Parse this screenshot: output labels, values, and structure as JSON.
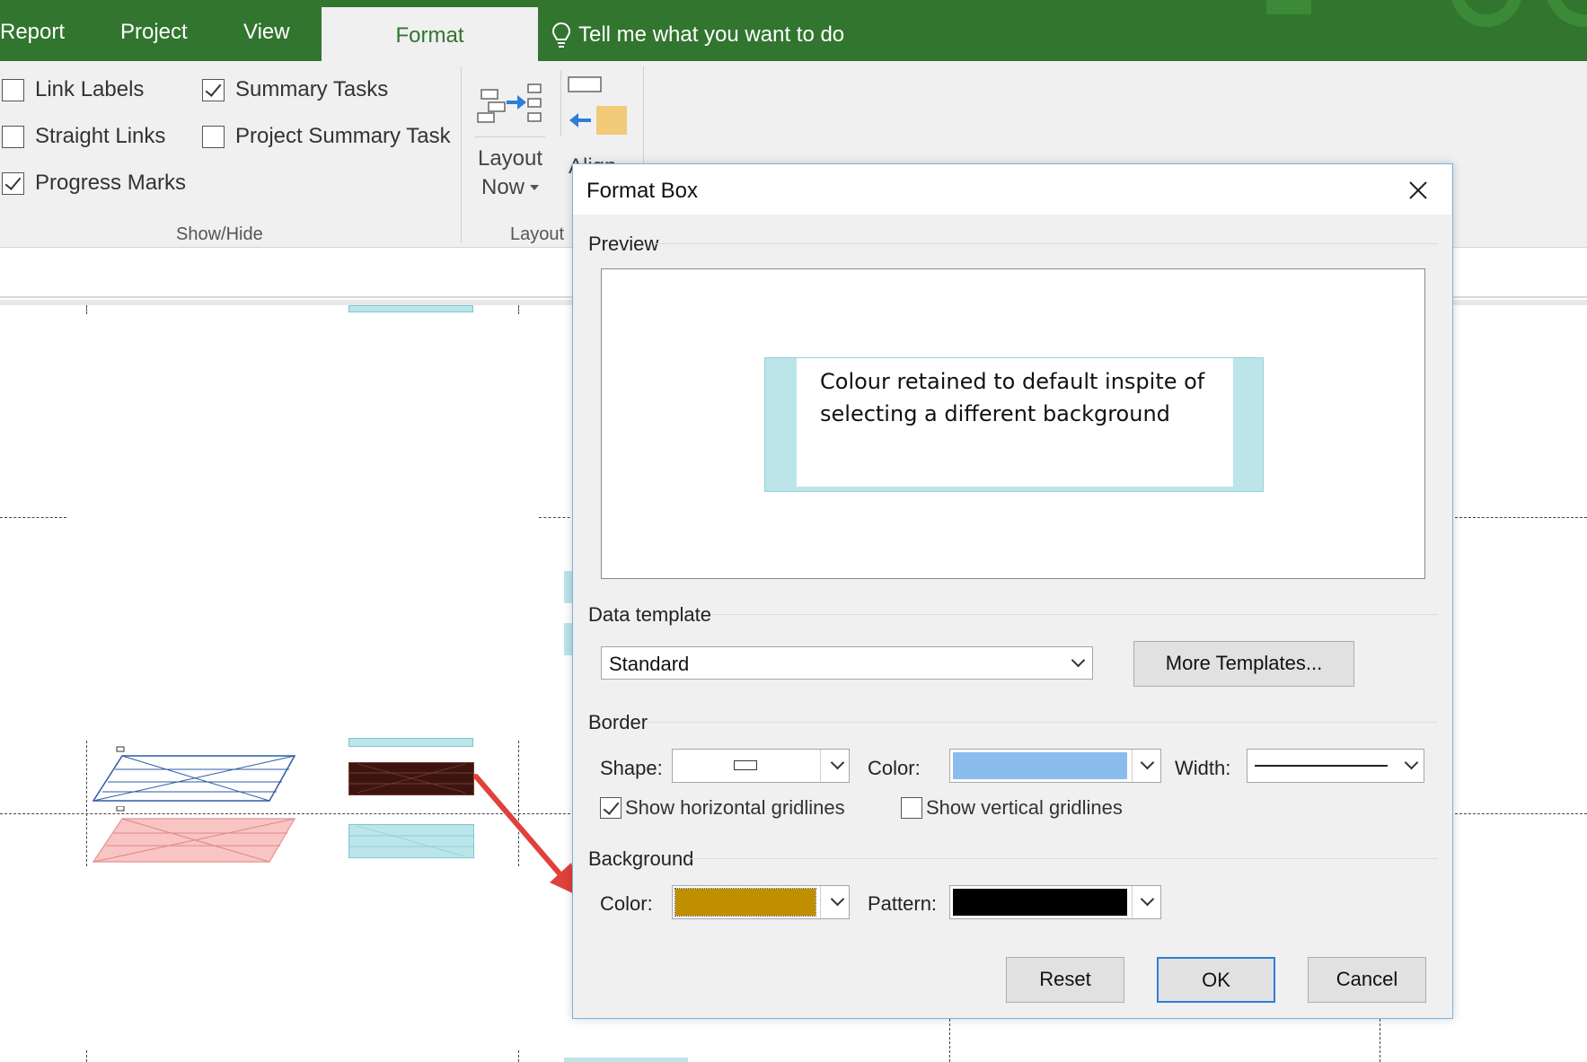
{
  "ribbon": {
    "tabs": [
      "Report",
      "Project",
      "View"
    ],
    "active_tab": "Format",
    "tell_me": "Tell me what you want to do",
    "show_hide": {
      "items": [
        {
          "label": "Link Labels",
          "checked": false
        },
        {
          "label": "Straight Links",
          "checked": false
        },
        {
          "label": "Progress Marks",
          "checked": true
        },
        {
          "label": "Summary Tasks",
          "checked": true
        },
        {
          "label": "Project Summary Task",
          "checked": false
        }
      ],
      "group_label": "Show/Hide"
    },
    "layout_now": {
      "line1": "Layout",
      "line2": "Now"
    },
    "align_label": "Align",
    "layout_group_label": "Layout"
  },
  "dialog": {
    "title": "Format Box",
    "preview_label": "Preview",
    "preview_text": "Colour retained to default inspite of selecting a different background",
    "data_template_label": "Data template",
    "data_template_value": "Standard",
    "more_templates_label": "More Templates...",
    "border_label": "Border",
    "shape_label": "Shape:",
    "border_color_label": "Color:",
    "border_color": "#8bbcee",
    "width_label": "Width:",
    "show_horizontal_gridlines": {
      "label": "Show horizontal gridlines",
      "checked": true
    },
    "show_vertical_gridlines": {
      "label": "Show vertical gridlines",
      "checked": false
    },
    "background_label": "Background",
    "bg_color_label": "Color:",
    "bg_color": "#bf8f00",
    "pattern_label": "Pattern:",
    "pattern_color": "#000000",
    "reset_label": "Reset",
    "ok_label": "OK",
    "cancel_label": "Cancel"
  },
  "colors": {
    "ribbon_green": "#31752f",
    "card_cyan": "#bce5ea",
    "card_pink": "#f9c4c4",
    "card_dark": "#3d1510",
    "annotation_arrow": "#e0413a"
  }
}
